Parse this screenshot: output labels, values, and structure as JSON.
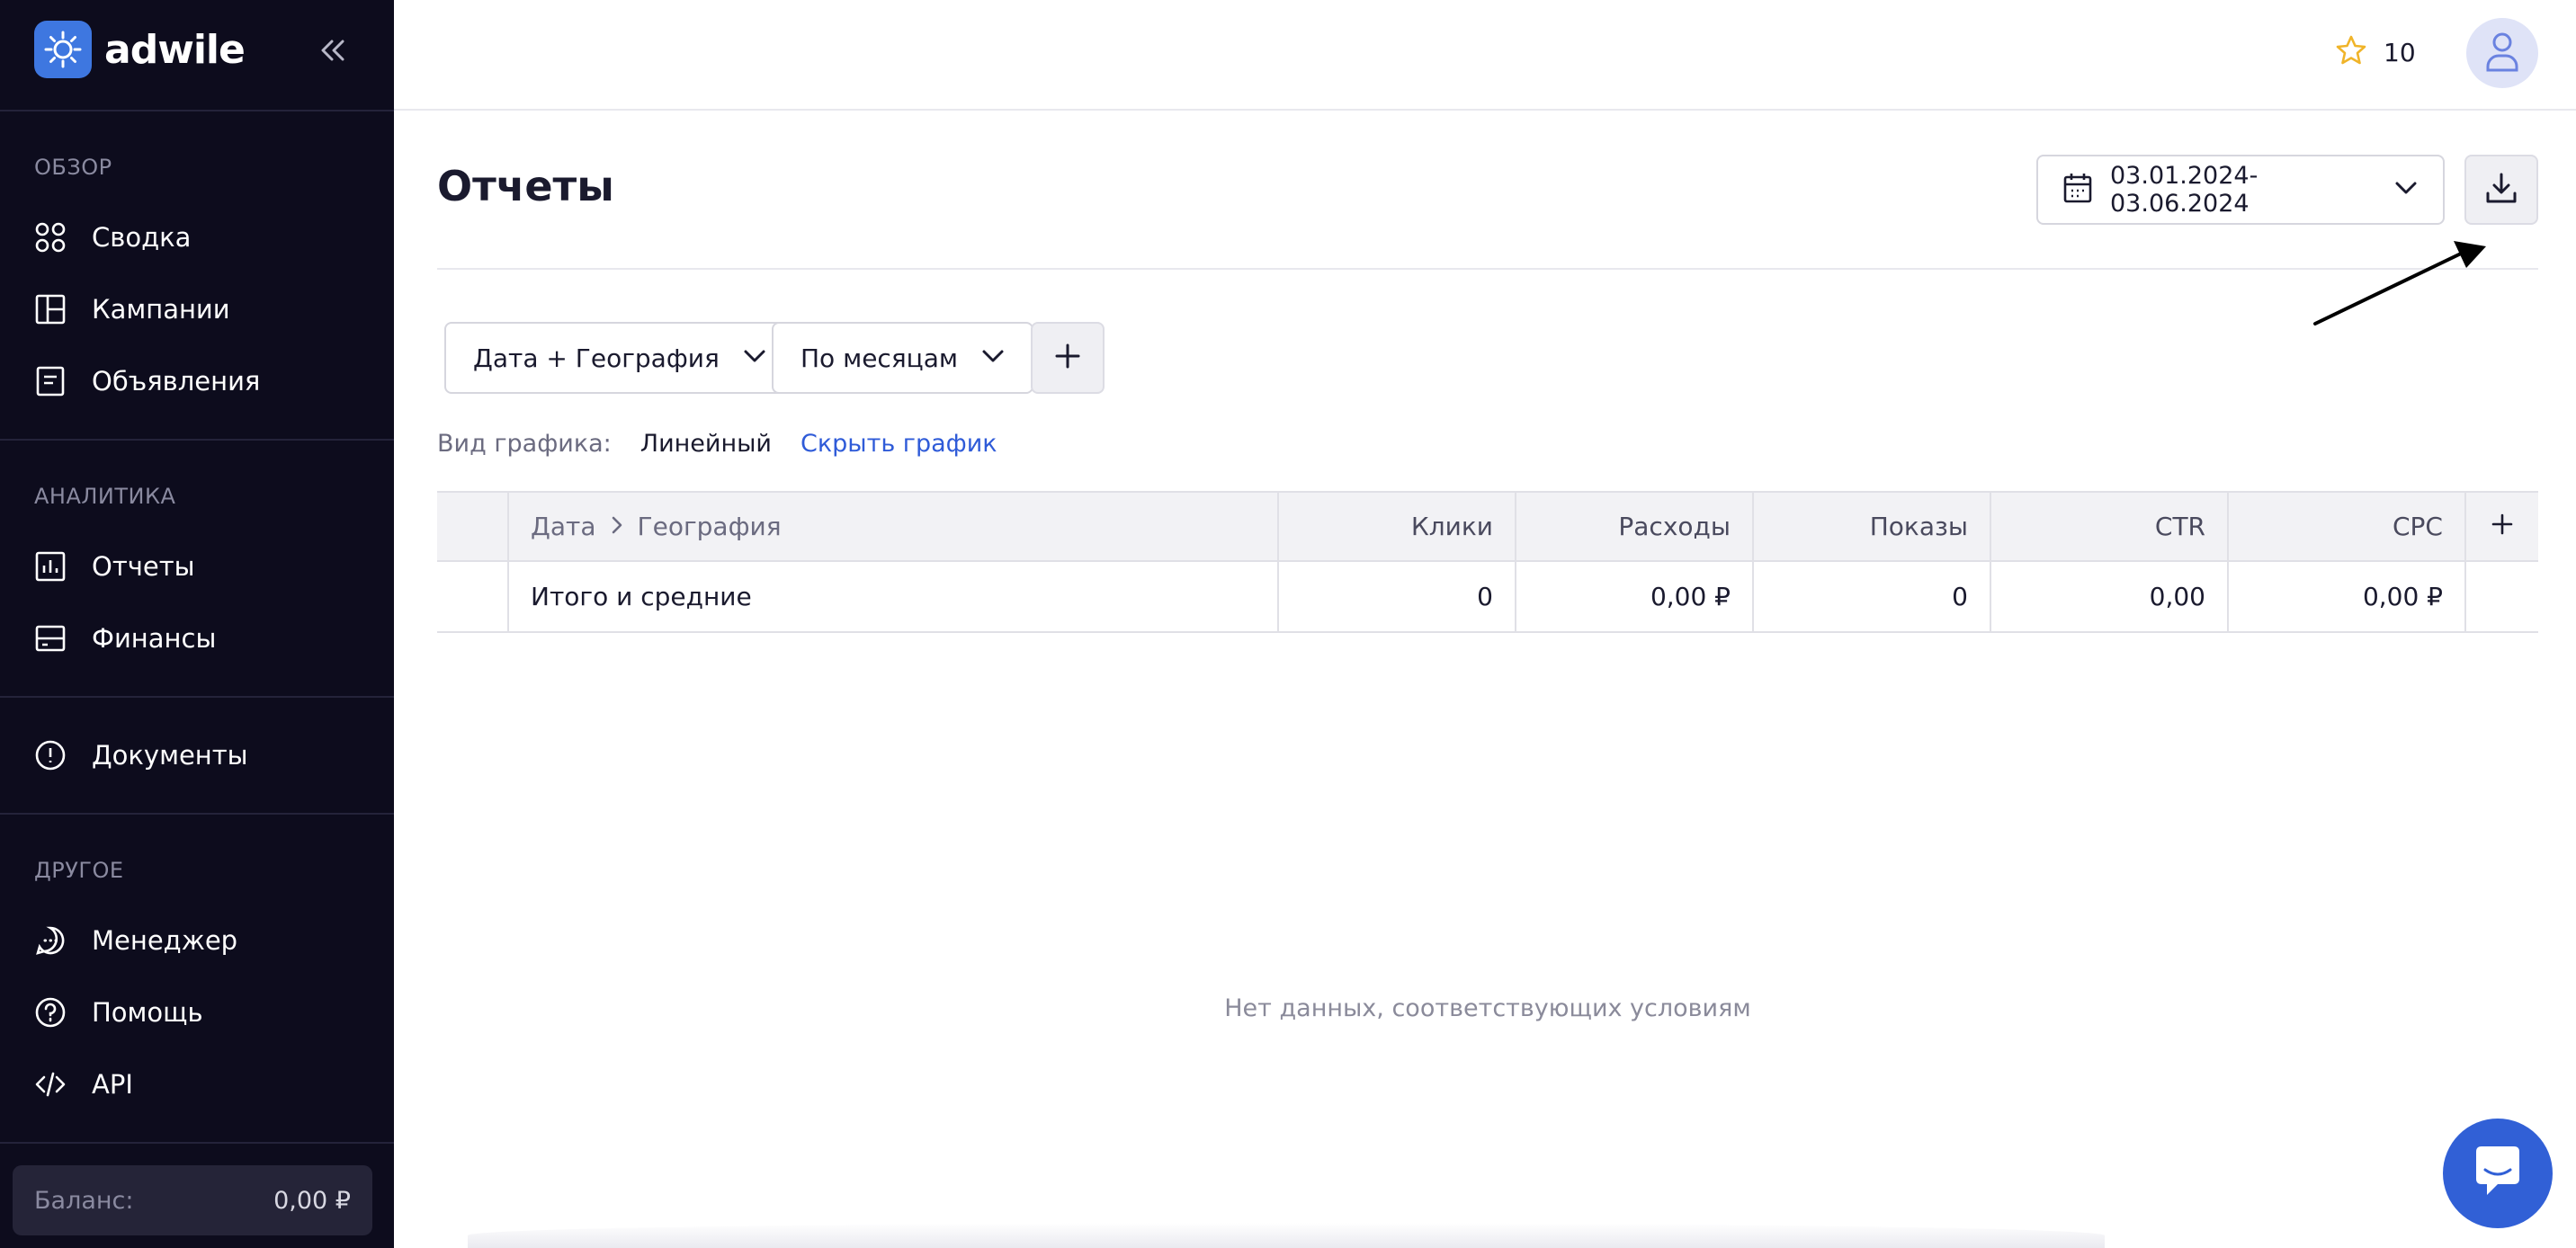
{
  "brand": {
    "name": "adwile",
    "accent": "#3e77e0"
  },
  "sidebar": {
    "sections": [
      {
        "label": "ОБЗОР"
      },
      {
        "label": "АНАЛИТИКА"
      },
      {
        "label": "ДРУГОЕ"
      }
    ],
    "items": [
      {
        "label": "Сводка",
        "icon": "grid-icon"
      },
      {
        "label": "Кампании",
        "icon": "layout-icon"
      },
      {
        "label": "Объявления",
        "icon": "document-icon"
      },
      {
        "label": "Отчеты",
        "icon": "bar-chart-icon"
      },
      {
        "label": "Финансы",
        "icon": "credit-card-icon"
      },
      {
        "label": "Документы",
        "icon": "alert-circle-icon"
      },
      {
        "label": "Менеджер",
        "icon": "chat-icon"
      },
      {
        "label": "Помощь",
        "icon": "help-circle-icon"
      },
      {
        "label": "API",
        "icon": "code-icon"
      }
    ],
    "balance": {
      "label": "Баланс:",
      "value": "0,00 ₽"
    }
  },
  "header": {
    "rating": "10"
  },
  "main": {
    "title": "Отчеты",
    "date_range": "03.01.2024-03.06.2024",
    "filters": {
      "grouping": "Дата + География",
      "period": "По месяцам"
    },
    "chart": {
      "label": "Вид графика:",
      "value": "Линейный",
      "hide": "Скрыть график"
    },
    "table": {
      "breadcrumb": [
        "Дата",
        "География"
      ],
      "columns": [
        "Клики",
        "Расходы",
        "Показы",
        "CTR",
        "CPC"
      ],
      "totals": {
        "label": "Итого и средние",
        "values": [
          "0",
          "0,00 ₽",
          "0",
          "0,00",
          "0,00 ₽"
        ]
      }
    },
    "empty_message": "Нет данных, соответствующих условиям"
  }
}
